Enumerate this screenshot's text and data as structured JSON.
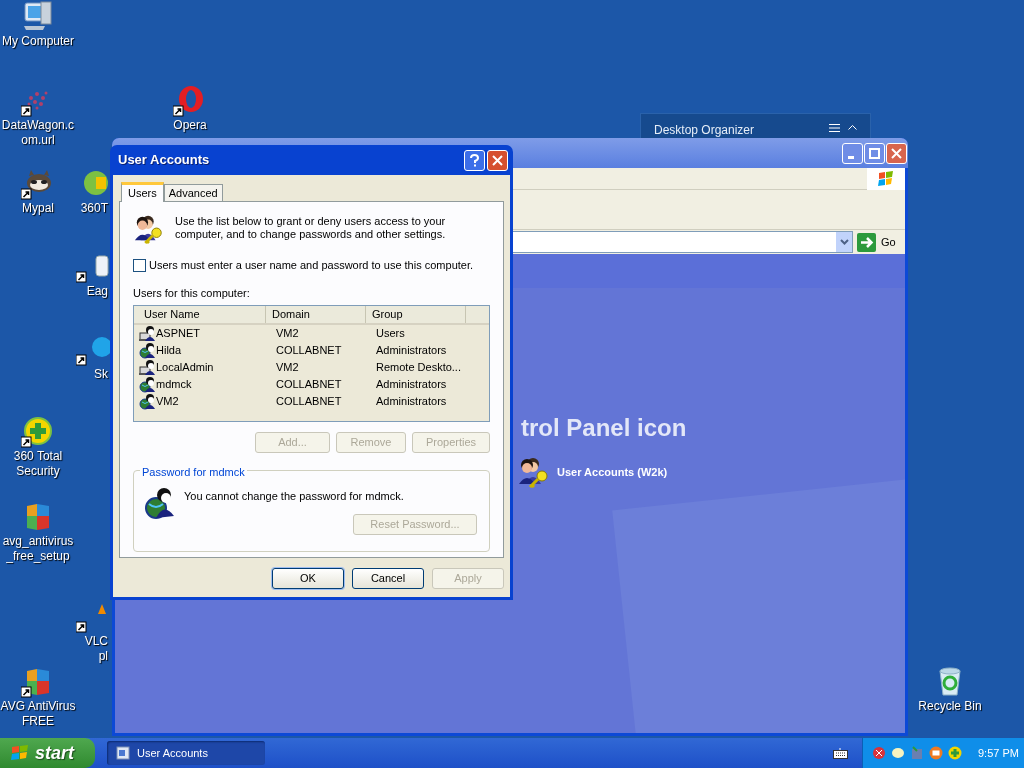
{
  "desktop_icons": [
    {
      "label": "My Computer",
      "shortcut": false
    },
    {
      "label": "DataWagon.c\nom.url",
      "shortcut": true
    },
    {
      "label": "Opera",
      "shortcut": true
    },
    {
      "label": "Mypal",
      "shortcut": true
    },
    {
      "label": "360T",
      "shortcut": false
    },
    {
      "label": "Eag",
      "shortcut": true
    },
    {
      "label": "Sk",
      "shortcut": true
    },
    {
      "label": "360 Total\nSecurity",
      "shortcut": true
    },
    {
      "label": "avg_antivirus\n_free_setup",
      "shortcut": false
    },
    {
      "label": "VLC\npl",
      "shortcut": true
    },
    {
      "label": "AVG AntiVirus\nFREE",
      "shortcut": true
    },
    {
      "label": "Recycle Bin",
      "shortcut": false
    }
  ],
  "desktop_organizer": {
    "title": "Desktop Organizer"
  },
  "control_panel_window": {
    "address_button": "Go",
    "heading": "trol Panel icon",
    "items": [
      {
        "label": "User Accounts (W2k)"
      }
    ]
  },
  "dialog": {
    "title": "User Accounts",
    "tabs": [
      {
        "label": "Users",
        "selected": true
      },
      {
        "label": "Advanced",
        "selected": false
      }
    ],
    "intro": "Use the list below to grant or deny users access to your computer, and to change passwords and other settings.",
    "require_login": {
      "label": "Users must enter a user name and password to use this computer.",
      "checked": false
    },
    "list_label": "Users for this computer:",
    "columns": [
      "User Name",
      "Domain",
      "Group"
    ],
    "rows": [
      {
        "kind": "local",
        "cells": [
          "ASPNET",
          "VM2",
          "Users"
        ]
      },
      {
        "kind": "domain",
        "cells": [
          "Hilda",
          "COLLABNET",
          "Administrators"
        ]
      },
      {
        "kind": "local",
        "cells": [
          "LocalAdmin",
          "VM2",
          "Remote Deskto..."
        ]
      },
      {
        "kind": "domain",
        "cells": [
          "mdmck",
          "COLLABNET",
          "Administrators"
        ]
      },
      {
        "kind": "domain",
        "cells": [
          "VM2",
          "COLLABNET",
          "Administrators"
        ]
      }
    ],
    "list_buttons": [
      {
        "label": "Add...",
        "disabled": true
      },
      {
        "label": "Remove",
        "disabled": true
      },
      {
        "label": "Properties",
        "disabled": true
      }
    ],
    "password_group": {
      "legend": "Password for mdmck",
      "message": "You cannot change the password for mdmck.",
      "button": {
        "label": "Reset Password...",
        "disabled": true
      }
    },
    "buttons": [
      {
        "label": "OK",
        "disabled": false
      },
      {
        "label": "Cancel",
        "disabled": false
      },
      {
        "label": "Apply",
        "disabled": true
      }
    ]
  },
  "taskbar": {
    "start": "start",
    "tasks": [
      {
        "label": "User Accounts",
        "selected": true
      }
    ],
    "clock": "9:57 PM"
  }
}
